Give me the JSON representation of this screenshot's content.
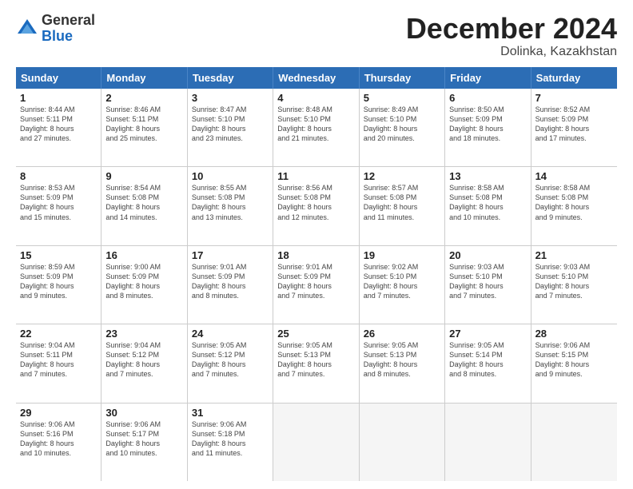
{
  "logo": {
    "general": "General",
    "blue": "Blue"
  },
  "title": "December 2024",
  "location": "Dolinka, Kazakhstan",
  "header_days": [
    "Sunday",
    "Monday",
    "Tuesday",
    "Wednesday",
    "Thursday",
    "Friday",
    "Saturday"
  ],
  "weeks": [
    [
      {
        "day": "1",
        "text": "Sunrise: 8:44 AM\nSunset: 5:11 PM\nDaylight: 8 hours\nand 27 minutes."
      },
      {
        "day": "2",
        "text": "Sunrise: 8:46 AM\nSunset: 5:11 PM\nDaylight: 8 hours\nand 25 minutes."
      },
      {
        "day": "3",
        "text": "Sunrise: 8:47 AM\nSunset: 5:10 PM\nDaylight: 8 hours\nand 23 minutes."
      },
      {
        "day": "4",
        "text": "Sunrise: 8:48 AM\nSunset: 5:10 PM\nDaylight: 8 hours\nand 21 minutes."
      },
      {
        "day": "5",
        "text": "Sunrise: 8:49 AM\nSunset: 5:10 PM\nDaylight: 8 hours\nand 20 minutes."
      },
      {
        "day": "6",
        "text": "Sunrise: 8:50 AM\nSunset: 5:09 PM\nDaylight: 8 hours\nand 18 minutes."
      },
      {
        "day": "7",
        "text": "Sunrise: 8:52 AM\nSunset: 5:09 PM\nDaylight: 8 hours\nand 17 minutes."
      }
    ],
    [
      {
        "day": "8",
        "text": "Sunrise: 8:53 AM\nSunset: 5:09 PM\nDaylight: 8 hours\nand 15 minutes."
      },
      {
        "day": "9",
        "text": "Sunrise: 8:54 AM\nSunset: 5:08 PM\nDaylight: 8 hours\nand 14 minutes."
      },
      {
        "day": "10",
        "text": "Sunrise: 8:55 AM\nSunset: 5:08 PM\nDaylight: 8 hours\nand 13 minutes."
      },
      {
        "day": "11",
        "text": "Sunrise: 8:56 AM\nSunset: 5:08 PM\nDaylight: 8 hours\nand 12 minutes."
      },
      {
        "day": "12",
        "text": "Sunrise: 8:57 AM\nSunset: 5:08 PM\nDaylight: 8 hours\nand 11 minutes."
      },
      {
        "day": "13",
        "text": "Sunrise: 8:58 AM\nSunset: 5:08 PM\nDaylight: 8 hours\nand 10 minutes."
      },
      {
        "day": "14",
        "text": "Sunrise: 8:58 AM\nSunset: 5:08 PM\nDaylight: 8 hours\nand 9 minutes."
      }
    ],
    [
      {
        "day": "15",
        "text": "Sunrise: 8:59 AM\nSunset: 5:09 PM\nDaylight: 8 hours\nand 9 minutes."
      },
      {
        "day": "16",
        "text": "Sunrise: 9:00 AM\nSunset: 5:09 PM\nDaylight: 8 hours\nand 8 minutes."
      },
      {
        "day": "17",
        "text": "Sunrise: 9:01 AM\nSunset: 5:09 PM\nDaylight: 8 hours\nand 8 minutes."
      },
      {
        "day": "18",
        "text": "Sunrise: 9:01 AM\nSunset: 5:09 PM\nDaylight: 8 hours\nand 7 minutes."
      },
      {
        "day": "19",
        "text": "Sunrise: 9:02 AM\nSunset: 5:10 PM\nDaylight: 8 hours\nand 7 minutes."
      },
      {
        "day": "20",
        "text": "Sunrise: 9:03 AM\nSunset: 5:10 PM\nDaylight: 8 hours\nand 7 minutes."
      },
      {
        "day": "21",
        "text": "Sunrise: 9:03 AM\nSunset: 5:10 PM\nDaylight: 8 hours\nand 7 minutes."
      }
    ],
    [
      {
        "day": "22",
        "text": "Sunrise: 9:04 AM\nSunset: 5:11 PM\nDaylight: 8 hours\nand 7 minutes."
      },
      {
        "day": "23",
        "text": "Sunrise: 9:04 AM\nSunset: 5:12 PM\nDaylight: 8 hours\nand 7 minutes."
      },
      {
        "day": "24",
        "text": "Sunrise: 9:05 AM\nSunset: 5:12 PM\nDaylight: 8 hours\nand 7 minutes."
      },
      {
        "day": "25",
        "text": "Sunrise: 9:05 AM\nSunset: 5:13 PM\nDaylight: 8 hours\nand 7 minutes."
      },
      {
        "day": "26",
        "text": "Sunrise: 9:05 AM\nSunset: 5:13 PM\nDaylight: 8 hours\nand 8 minutes."
      },
      {
        "day": "27",
        "text": "Sunrise: 9:05 AM\nSunset: 5:14 PM\nDaylight: 8 hours\nand 8 minutes."
      },
      {
        "day": "28",
        "text": "Sunrise: 9:06 AM\nSunset: 5:15 PM\nDaylight: 8 hours\nand 9 minutes."
      }
    ],
    [
      {
        "day": "29",
        "text": "Sunrise: 9:06 AM\nSunset: 5:16 PM\nDaylight: 8 hours\nand 10 minutes."
      },
      {
        "day": "30",
        "text": "Sunrise: 9:06 AM\nSunset: 5:17 PM\nDaylight: 8 hours\nand 10 minutes."
      },
      {
        "day": "31",
        "text": "Sunrise: 9:06 AM\nSunset: 5:18 PM\nDaylight: 8 hours\nand 11 minutes."
      },
      {
        "day": "",
        "text": ""
      },
      {
        "day": "",
        "text": ""
      },
      {
        "day": "",
        "text": ""
      },
      {
        "day": "",
        "text": ""
      }
    ]
  ]
}
